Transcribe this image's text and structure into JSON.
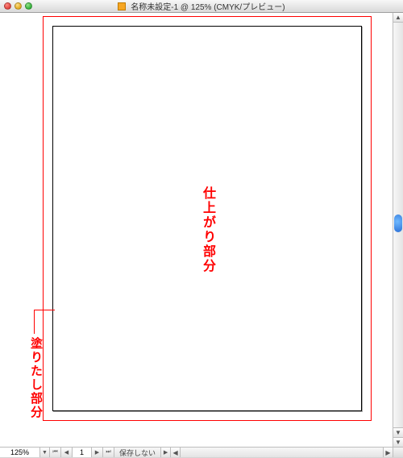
{
  "window": {
    "title": "名称未設定-1 @ 125% (CMYK/プレビュー)"
  },
  "labels": {
    "trim_area": "仕上がり部分",
    "bleed_area": "塗りたし部分"
  },
  "statusbar": {
    "zoom": "125%",
    "page_number": "1",
    "save_status": "保存しない"
  }
}
